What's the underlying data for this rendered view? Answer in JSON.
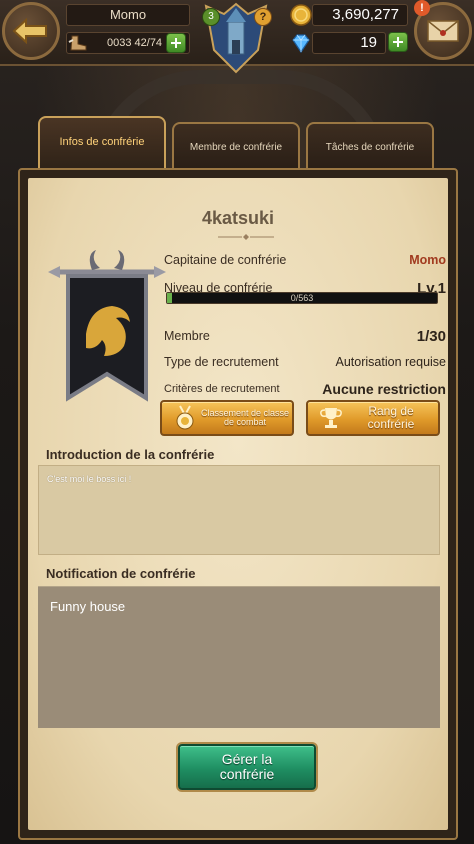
{
  "hud": {
    "player_name": "Momo",
    "xp_text": "0033 42/74",
    "gold": "3,690,277",
    "gems": "19",
    "badge_level": "3"
  },
  "tabs": [
    {
      "label": "Infos de confrérie",
      "active": true
    },
    {
      "label": "Membre de confrérie",
      "active": false
    },
    {
      "label": "Tâches de confrérie",
      "active": false
    }
  ],
  "guild": {
    "name": "4katsuki",
    "captain_label": "Capitaine de confrérie",
    "captain_value": "Momo",
    "level_label": "Niveau de confrérie",
    "level_value": "Lv.1",
    "xp_text": "0/563",
    "xp_progress": 0.02,
    "member_label": "Membre",
    "member_value": "1/30",
    "recruit_type_label": "Type de recrutement",
    "recruit_type_value": "Autorisation requise",
    "recruit_criteria_label": "Critères de recrutement",
    "recruit_criteria_value": "Aucune restriction"
  },
  "buttons": {
    "ranking_combat": "Classement de classe de combat",
    "guild_rank": "Rang de confrérie",
    "manage": "Gérer la confrérie"
  },
  "intro": {
    "title": "Introduction de la confrérie",
    "text": "C'est moi le boss ici !"
  },
  "notification": {
    "title": "Notification de confrérie",
    "text": "Funny house"
  },
  "colors": {
    "accent_gold": "#e09a2a",
    "manage_green": "#1f8e62",
    "captain_red": "#a13a1f"
  }
}
